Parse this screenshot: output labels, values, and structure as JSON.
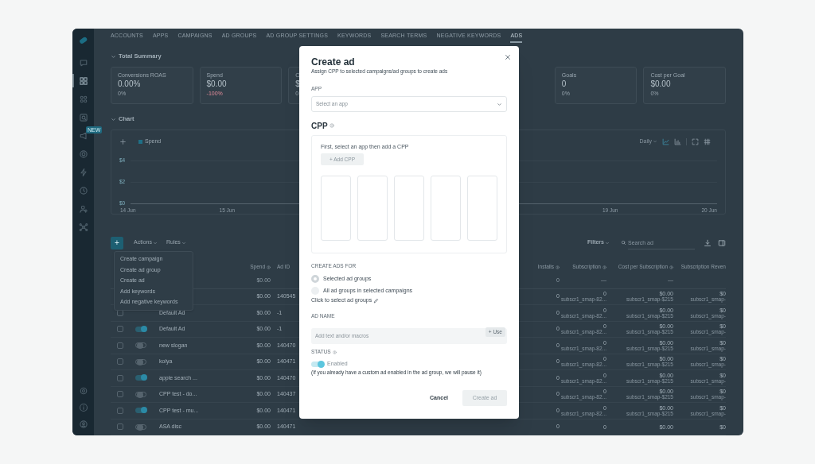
{
  "sidebar": {
    "items": [
      {
        "selected": false
      },
      {
        "selected": true
      },
      {
        "selected": false
      },
      {
        "selected": false
      },
      {
        "selected": false,
        "badge": "NEW"
      },
      {
        "selected": false
      },
      {
        "selected": false
      },
      {
        "selected": false
      },
      {
        "selected": false
      },
      {
        "selected": false
      }
    ]
  },
  "tabs": [
    {
      "label": "ACCOUNTS",
      "selected": false
    },
    {
      "label": "APPS",
      "selected": false
    },
    {
      "label": "CAMPAIGNS",
      "selected": false
    },
    {
      "label": "AD GROUPS",
      "selected": false
    },
    {
      "label": "AD GROUP SETTINGS",
      "selected": false
    },
    {
      "label": "KEYWORDS",
      "selected": false
    },
    {
      "label": "SEARCH TERMS",
      "selected": false
    },
    {
      "label": "NEGATIVE KEYWORDS",
      "selected": false
    },
    {
      "label": "ADS",
      "selected": true
    }
  ],
  "summary": {
    "title": "Total Summary",
    "expanded": true,
    "cards": [
      {
        "label": "Conversions ROAS",
        "value": "0.00%",
        "change": "0%",
        "negative": false
      },
      {
        "label": "Spend",
        "value": "$0.00",
        "change": "-100%",
        "negative": true
      },
      {
        "label": "C",
        "value": "$",
        "change": "0",
        "negative": false
      },
      {
        "label": "Goals",
        "value": "0",
        "change": "0%",
        "negative": false
      },
      {
        "label": "Cost per Goal",
        "value": "$0.00",
        "change": "0%",
        "negative": false
      }
    ]
  },
  "chart": {
    "title": "Chart",
    "expanded": true,
    "legend": {
      "label": "Spend",
      "color": "#1f6f86"
    },
    "period": "Daily",
    "y_labels": [
      "$4",
      "$2",
      "$0"
    ],
    "x_labels": [
      "14 Jun",
      "15 Jun",
      "19 Jun",
      "20 Jun"
    ]
  },
  "toolbar": {
    "add": "+",
    "actions": "Actions",
    "rules": "Rules",
    "filters": "Filters",
    "search_placeholder": "Search ad"
  },
  "actions_menu": {
    "items": [
      "Create campaign",
      "Create ad group",
      "Create ad",
      "Add keywords",
      "Add negative keywords"
    ]
  },
  "table": {
    "columns": [
      {
        "label": "Spend",
        "info": true
      },
      {
        "label": "Ad ID",
        "info": false
      },
      {
        "label": "Installs",
        "info": true
      },
      {
        "label": "Subscription",
        "info": true
      },
      {
        "label": "Cost per Subscription",
        "info": true
      },
      {
        "label": "Subscription Reven",
        "info": false
      }
    ],
    "totals": {
      "spend": "$0.00",
      "installs": "0",
      "subscription": "—",
      "cost": "—"
    },
    "rows": [
      {
        "spend": "$0.00",
        "ad_id": "140545",
        "installs": "0",
        "subscription": "0",
        "subscription_note": "subscr1_smap-82...",
        "cost": "$0.00",
        "cost_note": "subscr1_smap-$215",
        "revenue": "$0",
        "revenue_note": "subscr1_smap-"
      },
      {
        "checked": false,
        "name": "Default Ad",
        "spend": "$0.00",
        "ad_id": "-1",
        "installs": "0",
        "subscription": "0",
        "subscription_note": "subscr1_smap-82...",
        "cost": "$0.00",
        "cost_note": "subscr1_smap-$215",
        "revenue": "$0",
        "revenue_note": "subscr1_smap-"
      },
      {
        "checked": false,
        "name": "Default Ad",
        "enabled": true,
        "spend": "$0.00",
        "ad_id": "-1",
        "installs": "0",
        "subscription": "0",
        "subscription_note": "subscr1_smap-82...",
        "cost": "$0.00",
        "cost_note": "subscr1_smap-$215",
        "revenue": "$0",
        "revenue_note": "subscr1_smap-"
      },
      {
        "checked": false,
        "name": "new slogan",
        "enabled": false,
        "spend": "$0.00",
        "ad_id": "140470",
        "installs": "0",
        "subscription": "0",
        "subscription_note": "subscr1_smap-82...",
        "cost": "$0.00",
        "cost_note": "subscr1_smap-$215",
        "revenue": "$0",
        "revenue_note": "subscr1_smap-"
      },
      {
        "checked": false,
        "name": "kolya",
        "enabled": false,
        "spend": "$0.00",
        "ad_id": "140471",
        "installs": "0",
        "subscription": "0",
        "subscription_note": "subscr1_smap-82...",
        "cost": "$0.00",
        "cost_note": "subscr1_smap-$215",
        "revenue": "$0",
        "revenue_note": "subscr1_smap-"
      },
      {
        "checked": false,
        "name": "apple search ...",
        "enabled": true,
        "spend": "$0.00",
        "ad_id": "140470",
        "installs": "0",
        "subscription": "0",
        "subscription_note": "subscr1_smap-82...",
        "cost": "$0.00",
        "cost_note": "subscr1_smap-$215",
        "revenue": "$0",
        "revenue_note": "subscr1_smap-"
      },
      {
        "checked": false,
        "name": "CPP test - do...",
        "enabled": false,
        "spend": "$0.00",
        "ad_id": "140437",
        "installs": "0",
        "subscription": "0",
        "subscription_note": "subscr1_smap-82...",
        "cost": "$0.00",
        "cost_note": "subscr1_smap-$215",
        "revenue": "$0",
        "revenue_note": "subscr1_smap-"
      },
      {
        "checked": false,
        "name": "CPP test - mu...",
        "enabled": true,
        "spend": "$0.00",
        "ad_id": "140471",
        "installs": "0",
        "subscription": "0",
        "subscription_note": "subscr1_smap-82...",
        "cost": "$0.00",
        "cost_note": "subscr1_smap-$215",
        "revenue": "$0",
        "revenue_note": "subscr1_smap-"
      },
      {
        "checked": false,
        "name": "ASA disc",
        "enabled": false,
        "spend": "$0.00",
        "ad_id": "140471",
        "installs": "0",
        "subscription": "0",
        "cost": "$0.00",
        "revenue": "$0"
      }
    ]
  },
  "modal": {
    "title": "Create ad",
    "subtitle": "Assign CPP to selected campaigns/ad groups to create ads",
    "app": {
      "label": "APP",
      "placeholder": "Select an app"
    },
    "cpp": {
      "title": "CPP",
      "hint": "First, select an app then add a CPP",
      "add_button": "+ Add CPP",
      "slots": [
        {
          "kind": "empty"
        },
        {
          "kind": "empty"
        },
        {
          "kind": "empty"
        },
        {
          "kind": "empty"
        },
        {
          "kind": "empty"
        }
      ]
    },
    "create_for": {
      "label": "CREATE ADS FOR",
      "options": [
        {
          "label": "Selected ad groups",
          "selected": true
        },
        {
          "label": "All ad groups in selected campaigns",
          "selected": false
        }
      ],
      "link": "Click to select ad groups"
    },
    "ad_name": {
      "label": "AD NAME",
      "placeholder": "Add text and/or macros",
      "use_button": "+ Use"
    },
    "status": {
      "label": "STATUS",
      "enabled": true,
      "state_label": "Enabled",
      "note": "(If you already have a custom ad enabled in the ad group, we will pause it)"
    },
    "buttons": [
      {
        "label": "Cancel",
        "kind": "secondary",
        "disabled": false
      },
      {
        "label": "Create ad",
        "kind": "primary",
        "disabled": true
      }
    ]
  }
}
